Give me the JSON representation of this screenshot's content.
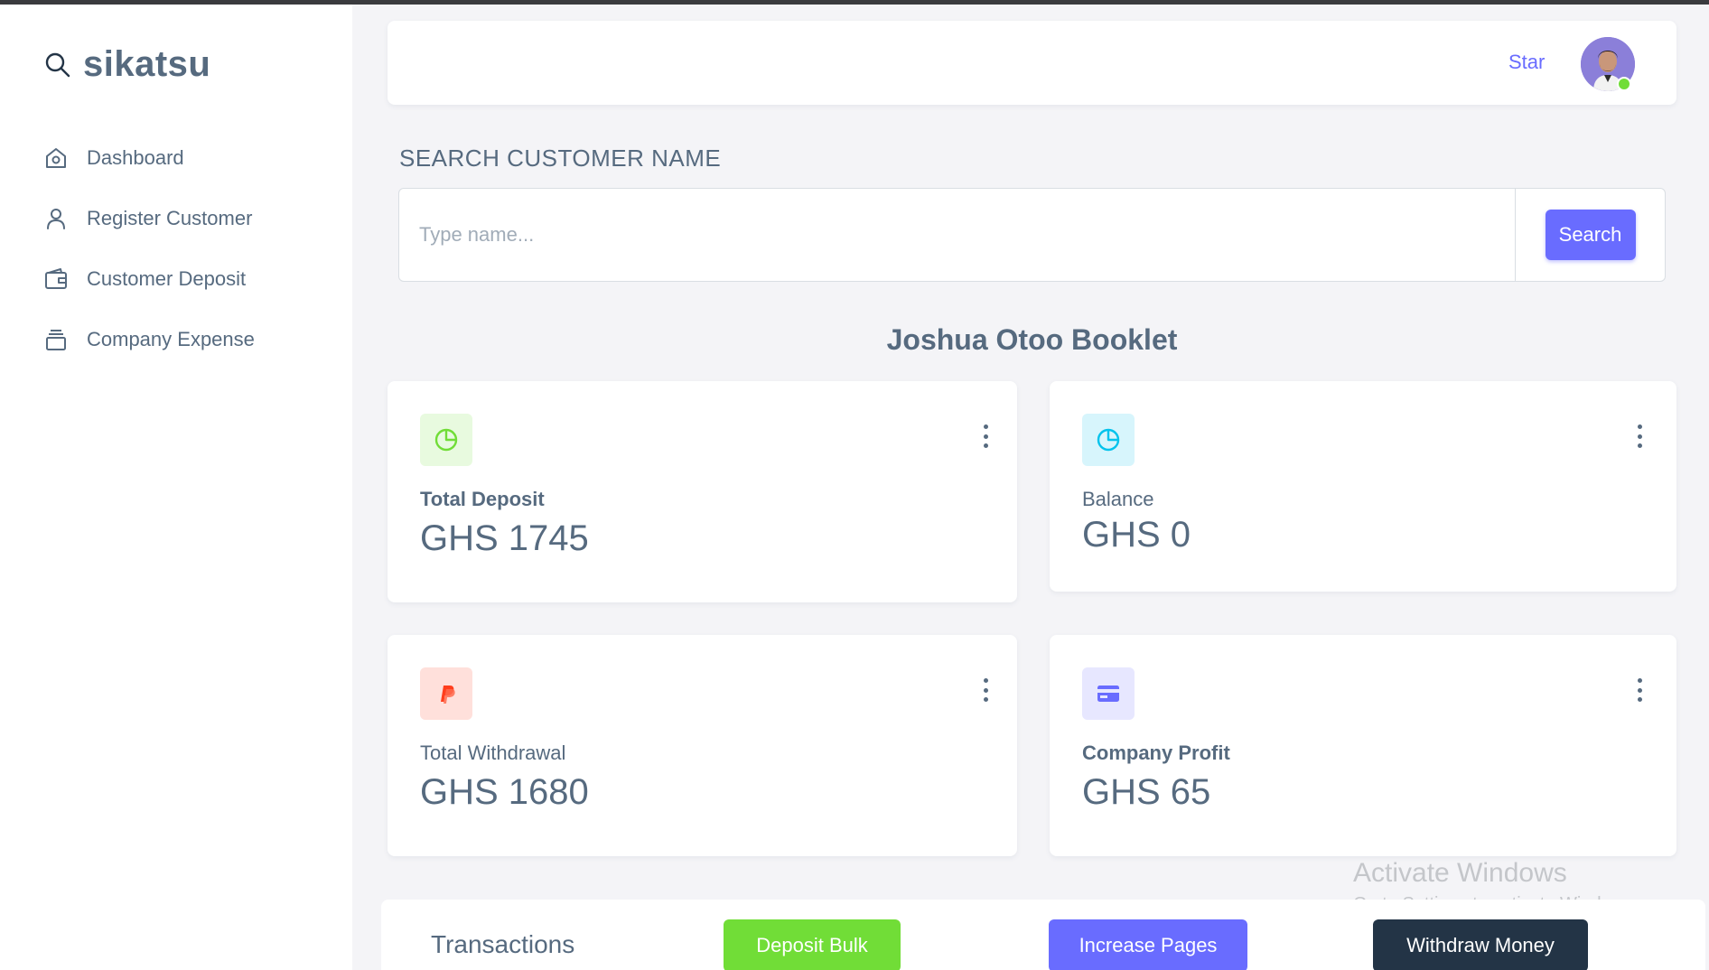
{
  "brand": {
    "name": "sikatsu",
    "icon": "search-icon"
  },
  "sidebar": {
    "items": [
      {
        "label": "Dashboard",
        "icon": "home-icon"
      },
      {
        "label": "Register Customer",
        "icon": "user-icon"
      },
      {
        "label": "Customer Deposit",
        "icon": "wallet-icon"
      },
      {
        "label": "Company Expense",
        "icon": "stack-icon"
      }
    ]
  },
  "navbar": {
    "link": "Star",
    "avatar": "user-avatar",
    "status": "online"
  },
  "search": {
    "heading": "SEARCH CUSTOMER NAME",
    "placeholder": "Type name...",
    "button": "Search"
  },
  "booklet": {
    "title": "Joshua Otoo Booklet"
  },
  "cards": [
    {
      "label": "Total Deposit",
      "value": "GHS 1745",
      "icon": "pie-chart-icon",
      "color": "#71dd37",
      "bg": "#e8fadf"
    },
    {
      "label": "Balance",
      "value": "GHS 0",
      "icon": "pie-chart-icon",
      "color": "#03c3ec",
      "bg": "#d7f5fc"
    },
    {
      "label": "Total Withdrawal",
      "value": "GHS 1680",
      "icon": "paypal-icon",
      "color": "#ff3e1d",
      "bg": "#ffe0db"
    },
    {
      "label": "Company Profit",
      "value": "GHS 65",
      "icon": "credit-card-icon",
      "color": "#696cff",
      "bg": "#e7e7ff"
    }
  ],
  "transactions": {
    "title": "Transactions",
    "buttons": [
      {
        "label": "Deposit Bulk",
        "color": "#71dd37"
      },
      {
        "label": "Increase Pages",
        "color": "#696cff"
      },
      {
        "label": "Withdraw Money",
        "color": "#233446"
      }
    ]
  },
  "watermark": {
    "title": "Activate Windows",
    "subtitle": "Go to Settings to activate Windows."
  }
}
